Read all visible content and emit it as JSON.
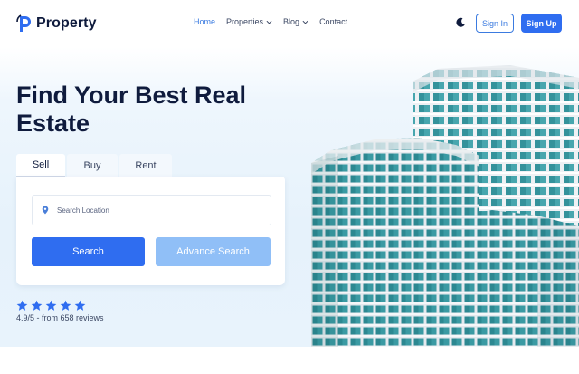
{
  "brand": {
    "name": "Property",
    "logo_color": "#2f6df0"
  },
  "nav": {
    "items": [
      {
        "label": "Home",
        "active": true,
        "has_dropdown": false
      },
      {
        "label": "Properties",
        "active": false,
        "has_dropdown": true
      },
      {
        "label": "Blog",
        "active": false,
        "has_dropdown": true
      },
      {
        "label": "Contact",
        "active": false,
        "has_dropdown": false
      }
    ],
    "theme_toggle_icon": "moon-icon",
    "signin_label": "Sign In",
    "signup_label": "Sign Up"
  },
  "hero": {
    "title": "Find Your Best Real Estate",
    "tabs": [
      {
        "label": "Sell",
        "active": true
      },
      {
        "label": "Buy",
        "active": false
      },
      {
        "label": "Rent",
        "active": false
      }
    ],
    "search": {
      "placeholder": "Search Location",
      "icon": "location-pin-icon",
      "search_label": "Search",
      "advance_label": "Advance Search"
    },
    "rating": {
      "stars": 5,
      "text": "4.9/5 - from 658 reviews"
    }
  },
  "colors": {
    "accent": "#2f6df0",
    "accent_light": "#90bff7",
    "heading": "#0f1b3d",
    "hero_bg": "#e6f2fb",
    "building_glass": "#2f8f98"
  }
}
